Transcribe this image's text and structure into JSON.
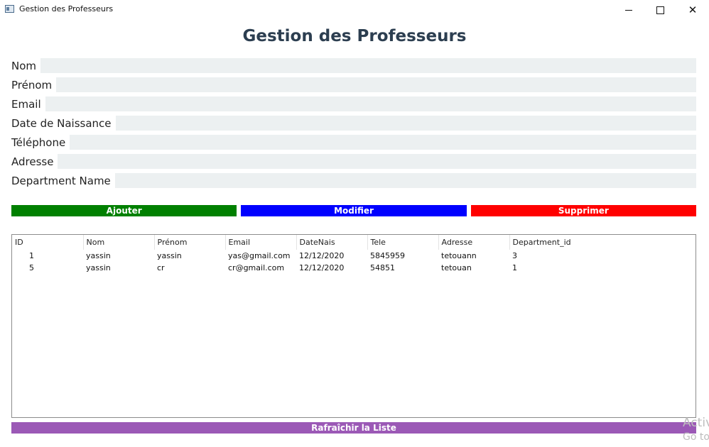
{
  "window": {
    "title": "Gestion des Professeurs",
    "minimize_glyph": "",
    "close_glyph": "✕"
  },
  "header": {
    "title": "Gestion des Professeurs"
  },
  "form": {
    "fields": [
      {
        "label": "Nom",
        "value": ""
      },
      {
        "label": "Prénom",
        "value": ""
      },
      {
        "label": "Email",
        "value": ""
      },
      {
        "label": "Date de Naissance",
        "value": ""
      },
      {
        "label": "Téléphone",
        "value": ""
      },
      {
        "label": "Adresse",
        "value": ""
      },
      {
        "label": "Department Name",
        "value": ""
      }
    ]
  },
  "actions": {
    "add_label": "Ajouter",
    "edit_label": "Modifier",
    "delete_label": "Supprimer",
    "colors": {
      "add": "#008000",
      "edit": "#0000ff",
      "delete": "#ff0000"
    }
  },
  "table": {
    "columns": [
      "ID",
      "Nom",
      "Prénom",
      "Email",
      "DateNais",
      "Tele",
      "Adresse",
      "Department_id"
    ],
    "rows": [
      [
        "1",
        "yassin",
        "yassin",
        "yas@gmail.com",
        "12/12/2020",
        "5845959",
        "tetouann",
        "3"
      ],
      [
        "5",
        "yassin",
        "cr",
        "cr@gmail.com",
        "12/12/2020",
        "54851",
        "tetouan",
        "1"
      ]
    ]
  },
  "refresh": {
    "label": "Rafraîchir la Liste",
    "color": "#9b59b6"
  },
  "watermark": {
    "line1": "Activ",
    "line2": "Go to"
  },
  "colors": {
    "title": "#2c3e50",
    "input_bg": "#ecf0f1"
  }
}
